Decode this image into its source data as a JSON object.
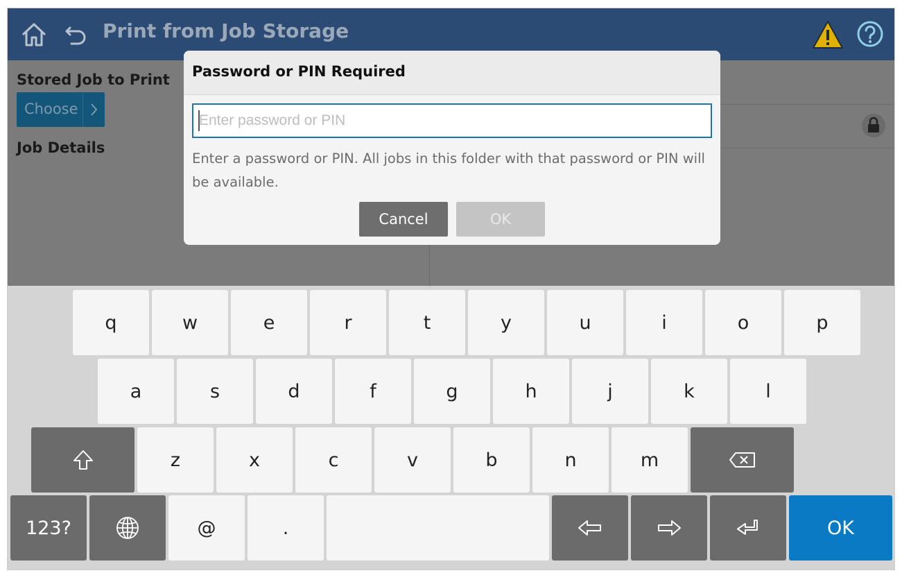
{
  "header": {
    "title": "Print from Job Storage",
    "home_icon": "home-icon",
    "back_icon": "back-arrow-icon",
    "warning_icon": "warning-triangle-icon",
    "help_icon": "help-circle-icon"
  },
  "left_panel": {
    "stored_job_label": "Stored Job to Print",
    "choose_label": "Choose",
    "choose_arrow": "›",
    "job_details_label": "Job Details"
  },
  "right_panel": {
    "lock_icon": "lock-icon"
  },
  "dialog": {
    "title": "Password or PIN Required",
    "input_value": "",
    "input_placeholder": "Enter password or PIN",
    "message": "Enter a password or PIN. All jobs in this folder with that password or PIN will be available.",
    "cancel_label": "Cancel",
    "ok_label": "OK"
  },
  "keyboard": {
    "row1": [
      "q",
      "w",
      "e",
      "r",
      "t",
      "y",
      "u",
      "i",
      "o",
      "p"
    ],
    "row2": [
      "a",
      "s",
      "d",
      "f",
      "g",
      "h",
      "j",
      "k",
      "l"
    ],
    "row3": [
      "z",
      "x",
      "c",
      "v",
      "b",
      "n",
      "m"
    ],
    "numbers_label": "123?",
    "at_label": "@",
    "period_label": ".",
    "ok_label": "OK",
    "shift_icon": "shift-arrow-icon",
    "backspace_icon": "backspace-icon",
    "globe_icon": "globe-icon",
    "left_arrow_icon": "left-arrow-icon",
    "right_arrow_icon": "right-arrow-icon",
    "enter_icon": "enter-icon"
  },
  "colors": {
    "header_bg": "#2b4b74",
    "accent_blue": "#0a7ac4",
    "choose_button": "#135679",
    "warning_yellow": "#e1b100"
  }
}
